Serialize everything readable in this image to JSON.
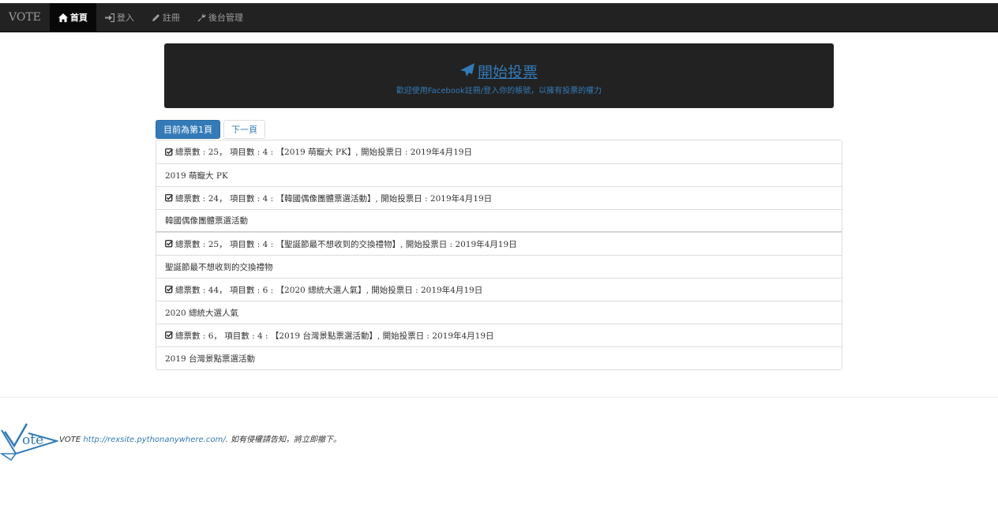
{
  "nav": {
    "brand": "VOTE",
    "items": [
      {
        "label": "首頁",
        "icon": "home-icon",
        "active": true
      },
      {
        "label": "登入",
        "icon": "login-icon",
        "active": false
      },
      {
        "label": "註冊",
        "icon": "pencil-icon",
        "active": false
      },
      {
        "label": "後台管理",
        "icon": "wrench-icon",
        "active": false
      }
    ]
  },
  "hero": {
    "title": "開始投票",
    "title_icon": "send-icon",
    "subtitle": "歡迎使用Facebook註冊/登入你的帳號，以擁有投票的權力"
  },
  "pager": {
    "current": "目前為第1頁",
    "next": "下一頁"
  },
  "polls": [
    {
      "summary": "總票數 : 25， 項目數 : 4 : 【2019 萌寵大 PK】, 開始投票日 : 2019年4月19日",
      "name": "2019 萌寵大 PK"
    },
    {
      "summary": "總票數 : 24， 項目數 : 4 : 【韓國偶像團體票選活動】, 開始投票日 : 2019年4月19日",
      "name": "韓國偶像團體票選活動"
    },
    {
      "summary": "總票數 : 25， 項目數 : 4 : 【聖誕節最不想收到的交換禮物】, 開始投票日 : 2019年4月19日",
      "name": "聖誕節最不想收到的交換禮物"
    },
    {
      "summary": "總票數 : 44， 項目數 : 6 : 【2020 總統大選人氣】, 開始投票日 : 2019年4月19日",
      "name": "2020 總統大選人氣"
    },
    {
      "summary": "總票數 : 6， 項目數 : 4 : 【2019 台灣景點票選活動】, 開始投票日 : 2019年4月19日",
      "name": "2019 台灣景點票選活動"
    }
  ],
  "footer": {
    "logo_text": "Vote",
    "brand": "VOTE",
    "link": "http://rexsite.pythonanywhere.com/",
    "notice": ". 如有侵權請告知，將立即撤下。"
  },
  "colors": {
    "navbar": "#222222",
    "accent": "#337ab7"
  }
}
